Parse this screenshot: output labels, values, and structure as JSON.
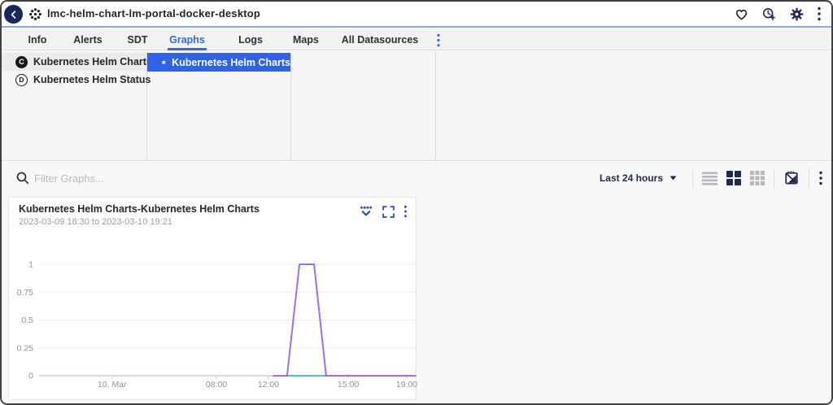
{
  "topbar": {
    "title": "lmc-helm-chart-lm-portal-docker-desktop",
    "icons": [
      "back-chevron",
      "resource-dots",
      "heart",
      "sdt-clock-add",
      "gear",
      "kebab-menu"
    ]
  },
  "tabs": {
    "items": [
      {
        "label": "Info"
      },
      {
        "label": "Alerts"
      },
      {
        "label": "SDT"
      },
      {
        "label": "Graphs"
      },
      {
        "label": "Logs"
      },
      {
        "label": "Maps"
      },
      {
        "label": "All Datasources"
      }
    ],
    "active_index": 3,
    "overflow_icon": "kebab-menu"
  },
  "datasource_tree": {
    "items": [
      {
        "badge": "C",
        "label": "Kubernetes Helm Charts",
        "selected": true
      },
      {
        "badge": "D",
        "label": "Kubernetes Helm Status",
        "selected": false
      }
    ]
  },
  "instance_panel": {
    "selected": {
      "label": "Kubernetes Helm Charts",
      "icon": "pie-chart"
    }
  },
  "filter_bar": {
    "placeholder": "Filter Graphs...",
    "time_range": "Last 24 hours",
    "view_icons": [
      "list-view",
      "grid-2x2",
      "grid-3x3",
      "no-chart",
      "kebab-menu"
    ],
    "active_view": "grid-2x2"
  },
  "chart_card": {
    "title": "Kubernetes Helm Charts-Kubernetes Helm Charts",
    "time_range": "2023-03-09 18:30 to 2023-03-10 19:21",
    "icons": [
      "dots-chevron",
      "expand",
      "kebab-menu"
    ]
  },
  "chart_data": {
    "type": "line",
    "title": "Kubernetes Helm Charts-Kubernetes Helm Charts",
    "subtitle": "2023-03-09 18:30 to 2023-03-10 19:21",
    "ylim": [
      0,
      1
    ],
    "grid": "horizontal",
    "legend": "none",
    "yticks": [
      {
        "v": 0,
        "label": "0"
      },
      {
        "v": 0.25,
        "label": "0.25"
      },
      {
        "v": 0.5,
        "label": "0.5"
      },
      {
        "v": 0.75,
        "label": "0.75"
      },
      {
        "v": 1,
        "label": "1"
      }
    ],
    "x_domain": {
      "start": "2023-03-09 18:30",
      "end": "2023-03-10 19:21",
      "start_min": 1110,
      "end_min": 2601
    },
    "xticks": [
      {
        "t_min": 1440,
        "label": "10. Mar"
      },
      {
        "t_min": 1920,
        "label": "08:00"
      },
      {
        "t_min": 2160,
        "label": "12:00"
      },
      {
        "t_min": 2340,
        "label": "15:00"
      },
      {
        "t_min": 2580,
        "label": "19:00"
      }
    ],
    "x_anchors": {
      "t_min": [
        1110,
        1440,
        1920,
        2160,
        2340,
        2580,
        2601
      ],
      "frac": [
        0,
        0.194,
        0.471,
        0.609,
        0.821,
        0.976,
        1
      ]
    },
    "series": [
      {
        "name": "teal-series",
        "color": "#41c9be",
        "points": [
          [
            2200,
            0
          ],
          [
            2290,
            0
          ]
        ]
      },
      {
        "name": "purple-series",
        "color": "#9e6df0",
        "points": [
          [
            2171,
            0
          ],
          [
            2202,
            0
          ],
          [
            2230,
            1
          ],
          [
            2263,
            1
          ],
          [
            2290,
            0
          ],
          [
            2601,
            0
          ]
        ]
      }
    ]
  },
  "colors": {
    "accent_blue": "#2e62e9",
    "tab_blue": "#2f6be0",
    "navy_icon": "#1b2a55",
    "purple_line": "#9e6df0",
    "teal_line": "#41c9be",
    "axis_line": "#c5cfe4"
  }
}
